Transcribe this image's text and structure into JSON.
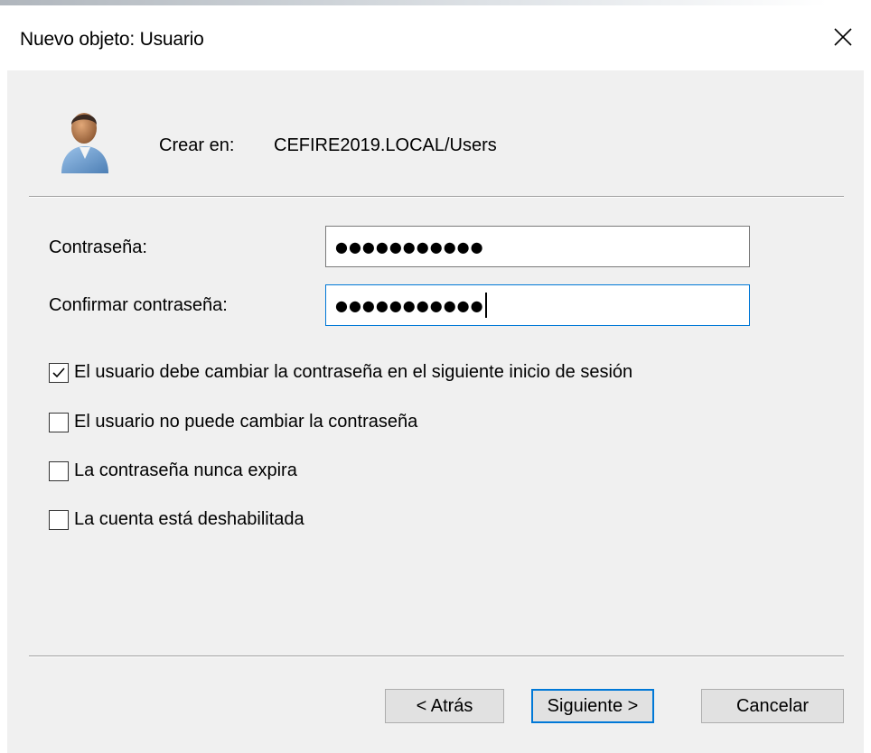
{
  "window": {
    "title": "Nuevo objeto: Usuario",
    "close_icon": "close-icon"
  },
  "header": {
    "icon": "user-icon",
    "create_label": "Crear en:",
    "create_path": "CEFIRE2019.LOCAL/Users"
  },
  "form": {
    "password": {
      "label": "Contraseña:",
      "masked_value": "●●●●●●●●●●●"
    },
    "confirm": {
      "label": "Confirmar contraseña:",
      "masked_value": "●●●●●●●●●●●"
    }
  },
  "options": [
    {
      "label": "El usuario debe cambiar la contraseña en el siguiente inicio de sesión",
      "checked": true
    },
    {
      "label": "El usuario no puede cambiar la contraseña",
      "checked": false
    },
    {
      "label": "La contraseña nunca expira",
      "checked": false
    },
    {
      "label": "La cuenta está deshabilitada",
      "checked": false
    }
  ],
  "buttons": {
    "back": "< Atrás",
    "next": "Siguiente >",
    "cancel": "Cancelar"
  },
  "colors": {
    "focus_accent": "#0078d7",
    "dialog_background": "#f0f0f0"
  }
}
